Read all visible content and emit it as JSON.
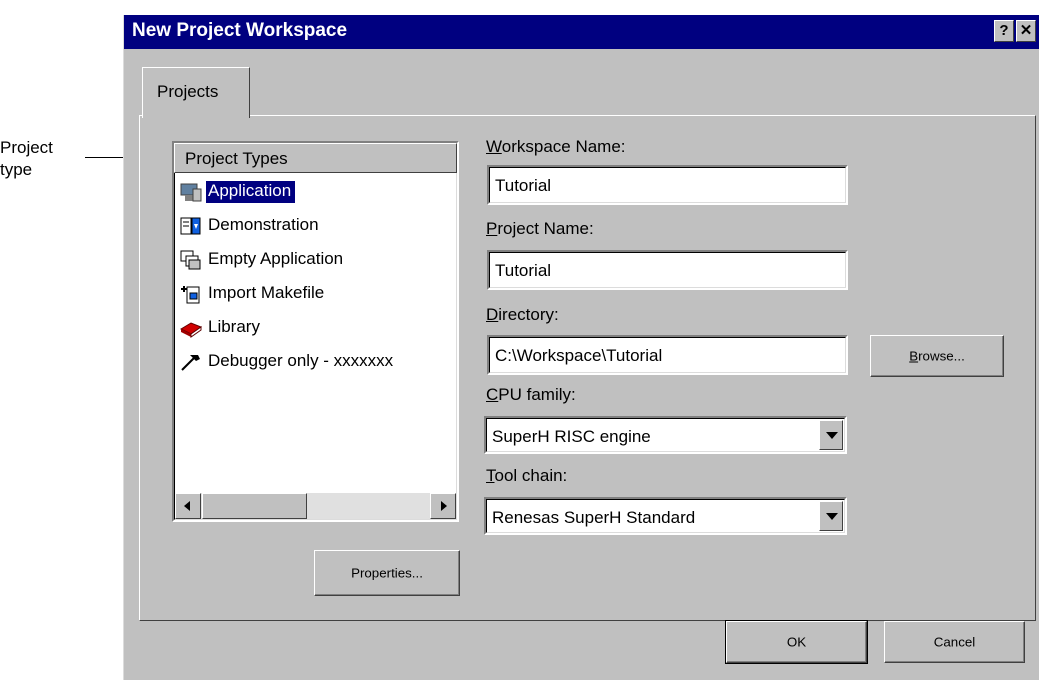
{
  "annotation": {
    "line1": "Project",
    "line2": "type"
  },
  "window": {
    "title": "New Project Workspace",
    "help_btn": "?",
    "close_btn": "✕"
  },
  "tabs": [
    {
      "label": "Projects"
    }
  ],
  "project_types": {
    "header": "Project Types",
    "items": [
      {
        "label": "Application",
        "icon": "application-icon",
        "selected": true
      },
      {
        "label": "Demonstration",
        "icon": "demonstration-icon"
      },
      {
        "label": "Empty Application",
        "icon": "empty-application-icon"
      },
      {
        "label": "Import Makefile",
        "icon": "import-makefile-icon"
      },
      {
        "label": "Library",
        "icon": "library-icon"
      },
      {
        "label": "Debugger only - xxxxxxx",
        "icon": "debugger-icon"
      }
    ]
  },
  "form": {
    "workspace_name": {
      "label_ul": "W",
      "label_rest": "orkspace Name:",
      "value": "Tutorial"
    },
    "project_name": {
      "label_ul": "P",
      "label_rest": "roject Name:",
      "value": "Tutorial"
    },
    "directory": {
      "label_ul": "D",
      "label_rest": "irectory:",
      "value": "C:\\Workspace\\Tutorial"
    },
    "cpu_family": {
      "label_ul": "C",
      "label_rest": "PU family:",
      "value": "SuperH RISC engine"
    },
    "tool_chain": {
      "label_ul": "T",
      "label_rest": "ool chain:",
      "value": "Renesas SuperH Standard"
    }
  },
  "buttons": {
    "browse_ul": "B",
    "browse_rest": "rowse...",
    "properties": "Properties...",
    "ok": "OK",
    "cancel": "Cancel"
  }
}
